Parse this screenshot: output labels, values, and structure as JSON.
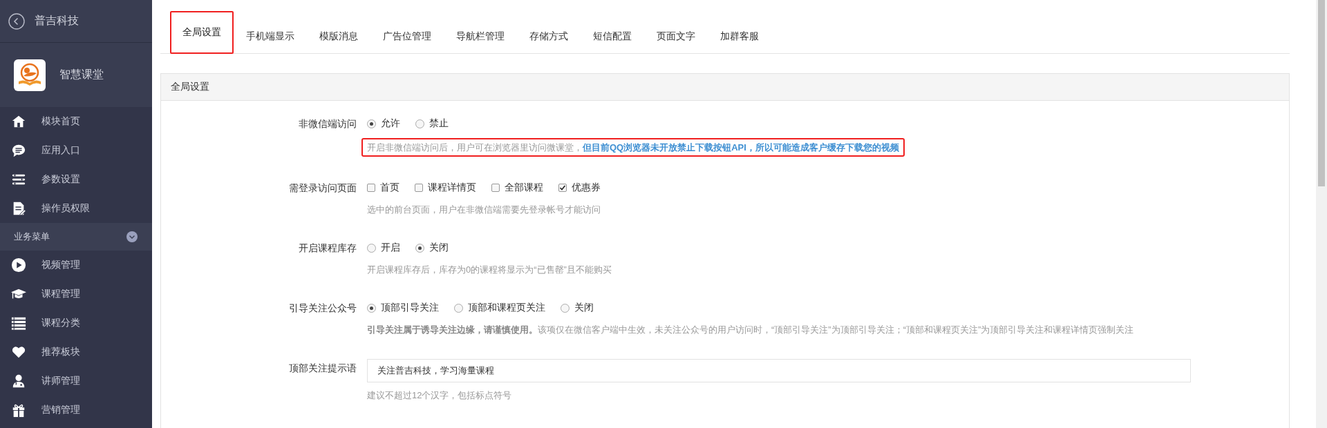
{
  "sidebar": {
    "title": "普吉科技",
    "app_name": "智慧课堂",
    "items": [
      {
        "label": "模块首页"
      },
      {
        "label": "应用入口"
      },
      {
        "label": "参数设置"
      },
      {
        "label": "操作员权限"
      }
    ],
    "section": {
      "label": "业务菜单",
      "expanded": true
    },
    "section_items": [
      {
        "label": "视频管理"
      },
      {
        "label": "课程管理"
      },
      {
        "label": "课程分类"
      },
      {
        "label": "推荐板块"
      },
      {
        "label": "讲师管理"
      },
      {
        "label": "营销管理"
      }
    ]
  },
  "tabs": [
    {
      "label": "全局设置",
      "selected": true,
      "highlighted": true
    },
    {
      "label": "手机端显示",
      "selected": false,
      "highlighted": false
    },
    {
      "label": "模版消息",
      "selected": false,
      "highlighted": false
    },
    {
      "label": "广告位管理",
      "selected": false,
      "highlighted": false
    },
    {
      "label": "导航栏管理",
      "selected": false,
      "highlighted": false
    },
    {
      "label": "存储方式",
      "selected": false,
      "highlighted": false
    },
    {
      "label": "短信配置",
      "selected": false,
      "highlighted": false
    },
    {
      "label": "页面文字",
      "selected": false,
      "highlighted": false
    },
    {
      "label": "加群客服",
      "selected": false,
      "highlighted": false
    }
  ],
  "panel": {
    "title": "全局设置",
    "fields": [
      {
        "kind": "radio",
        "label": "非微信端访问",
        "options": [
          {
            "label": "允许",
            "selected": true
          },
          {
            "label": "禁止",
            "selected": false
          }
        ],
        "hint": {
          "text": "开启非微信端访问后，用户可在浏览器里访问微课堂，**但目前QQ浏览器未开放禁止下载按钮API，所以可能造成客户缓存下载您的视频**",
          "accent": true,
          "highlighted": true
        }
      },
      {
        "kind": "checkbox",
        "label": "需登录访问页面",
        "options": [
          {
            "label": "首页",
            "checked": false
          },
          {
            "label": "课程详情页",
            "checked": false
          },
          {
            "label": "全部课程",
            "checked": false
          },
          {
            "label": "优惠券",
            "checked": true
          }
        ],
        "hint": {
          "text": "选中的前台页面，用户在非微信端需要先登录帐号才能访问",
          "highlighted": false
        }
      },
      {
        "kind": "radio",
        "label": "开启课程库存",
        "options": [
          {
            "label": "开启",
            "selected": false
          },
          {
            "label": "关闭",
            "selected": true
          }
        ],
        "hint": {
          "text": "开启课程库存后，库存为0的课程将显示为“已售罄”且不能购买",
          "highlighted": false
        }
      },
      {
        "kind": "radio",
        "label": "引导关注公众号",
        "options": [
          {
            "label": "顶部引导关注",
            "selected": true
          },
          {
            "label": "顶部和课程页关注",
            "selected": false
          },
          {
            "label": "关闭",
            "selected": false
          }
        ],
        "hint": {
          "text": "**引导关注属于诱导关注边缘，请谨慎使用。**该项仅在微信客户端中生效，未关注公众号的用户访问时，“顶部引导关注”为顶部引导关注；“顶部和课程页关注”为顶部引导关注和课程详情页强制关注",
          "accent": false,
          "highlighted": false
        }
      },
      {
        "kind": "text",
        "label": "顶部关注提示语",
        "value": "关注普吉科技，学习海量课程",
        "hint": {
          "text": "建议不超过12个汉字，包括标点符号",
          "highlighted": false
        }
      }
    ]
  }
}
